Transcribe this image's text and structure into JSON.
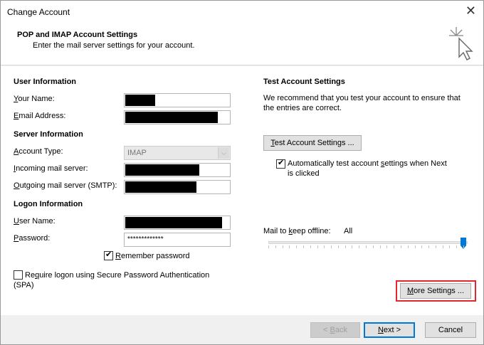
{
  "window": {
    "title": "Change Account"
  },
  "header": {
    "title": "POP and IMAP Account Settings",
    "subtitle": "Enter the mail server settings for your account."
  },
  "user_info": {
    "heading": "User Information",
    "name_label_ul": "Y",
    "name_label_rest": "our Name:",
    "email_label_ul": "E",
    "email_label_rest": "mail Address:"
  },
  "server_info": {
    "heading": "Server Information",
    "account_type_label_ul": "A",
    "account_type_label_rest": "ccount Type:",
    "account_type_value": "IMAP",
    "incoming_label_ul": "I",
    "incoming_label_rest": "ncoming mail server:",
    "outgoing_label_ul": "O",
    "outgoing_label_rest": "utgoing mail server (SMTP):"
  },
  "logon_info": {
    "heading": "Logon Information",
    "user_label_ul": "U",
    "user_label_rest": "ser Name:",
    "password_label_ul": "P",
    "password_label_rest": "assword:",
    "password_value": "*************",
    "remember_ul": "R",
    "remember_rest": "emember password",
    "remember_checked": true,
    "spa_ul": "q",
    "spa_pre": "Re",
    "spa_rest": "uire logon using Secure Password Authentication",
    "spa_line2": "(SPA)",
    "spa_checked": false
  },
  "test_settings": {
    "heading": "Test Account Settings",
    "description_line1": "We recommend that you test your account to ensure that",
    "description_line2": "the entries are correct.",
    "button_ul": "T",
    "button_rest": "est Account Settings ...",
    "auto_pre": "Automatically test account ",
    "auto_ul": "s",
    "auto_rest": "ettings when Next",
    "auto_line2": "is clicked",
    "auto_checked": true
  },
  "offline": {
    "label_pre": "Mail to ",
    "label_ul": "k",
    "label_rest": "eep offline:",
    "value": "All",
    "slider_position": 1.0
  },
  "more_settings": {
    "label_ul": "M",
    "label_rest": "ore Settings ..."
  },
  "footer": {
    "back_pre": "< ",
    "back_ul": "B",
    "back_rest": "ack",
    "next_ul": "N",
    "next_rest": "ext >",
    "cancel": "Cancel"
  },
  "colors": {
    "highlight": "#e2282e",
    "accent": "#0078d7"
  }
}
